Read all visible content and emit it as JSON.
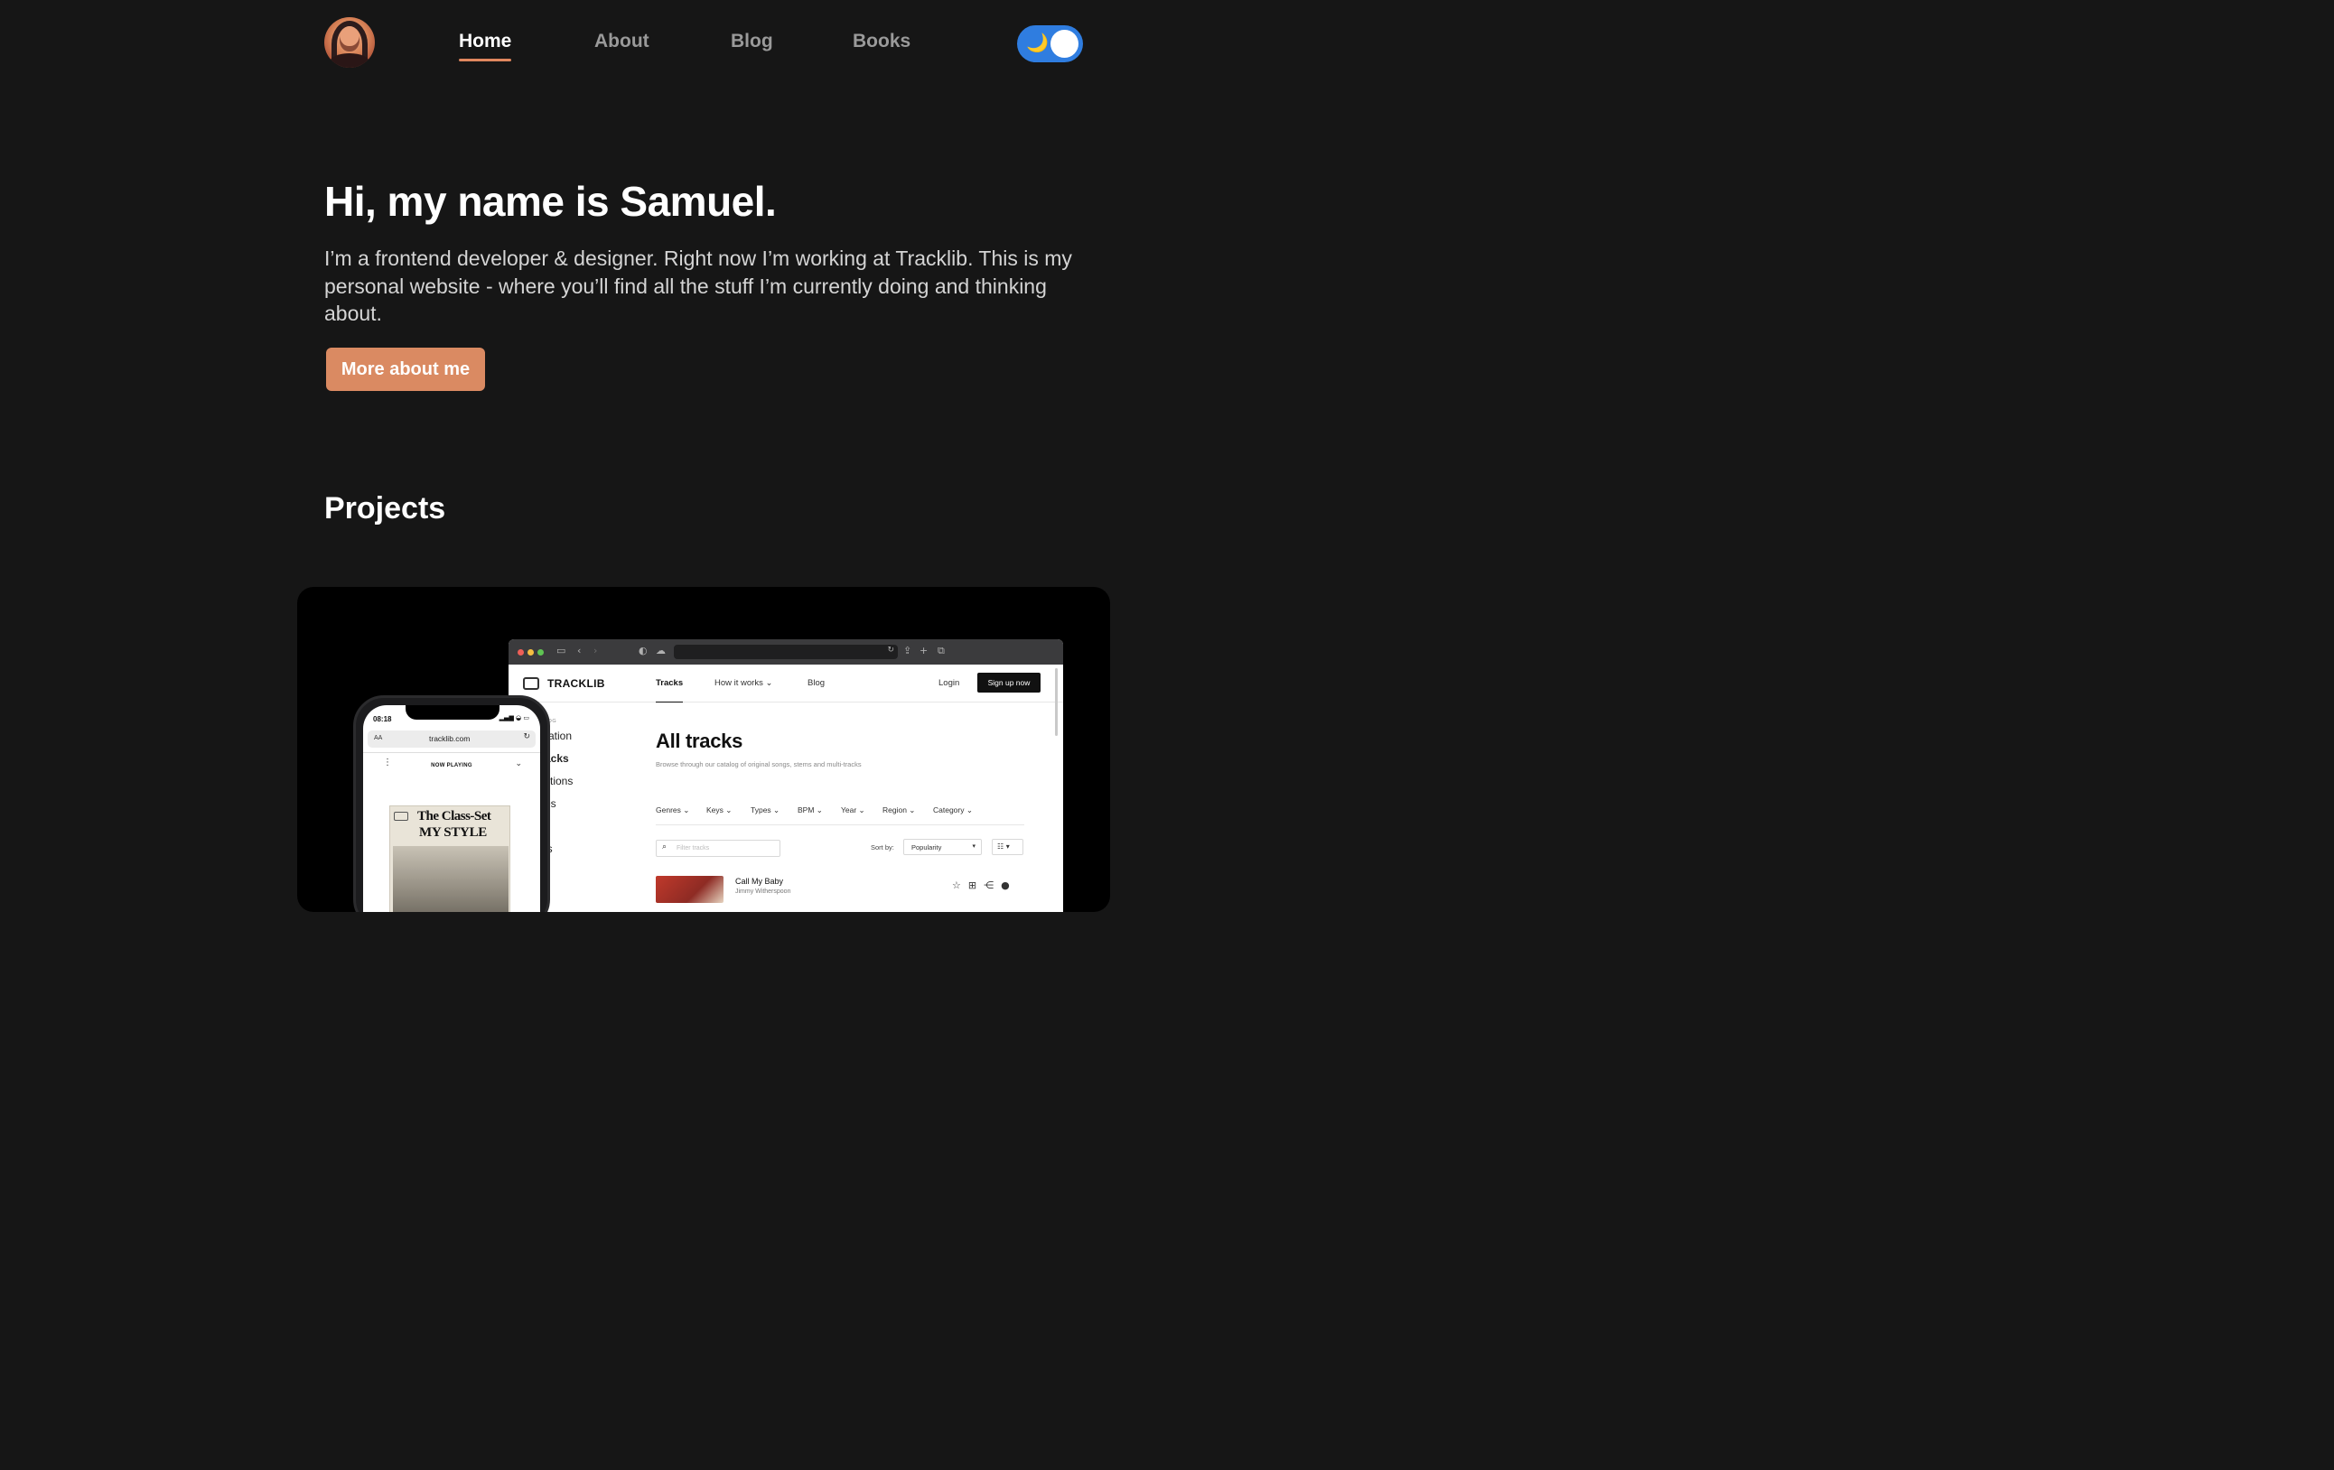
{
  "nav": {
    "avatar_alt": "Samuel",
    "links": [
      {
        "label": "Home",
        "active": true
      },
      {
        "label": "About",
        "active": false
      },
      {
        "label": "Blog",
        "active": false
      },
      {
        "label": "Books",
        "active": false
      }
    ],
    "theme_toggle": {
      "icon": "moon-icon",
      "state": "dark",
      "moon_glyph": "🌙"
    }
  },
  "hero": {
    "title": "Hi, my name is Samuel.",
    "text": "I’m a frontend developer & designer. Right now I’m working at Tracklib. This is my personal website - where you’ll find all the stuff I’m currently doing and thinking about.",
    "cta_label": "More about me"
  },
  "projects": {
    "title": "Projects",
    "tracklib_preview": {
      "browser": {
        "logo_text": "TRACKLIB",
        "nav": [
          "Tracks",
          "How it works ⌄",
          "Blog"
        ],
        "login": "Login",
        "signup": "Sign up now",
        "sidebar_fragments": [
          "ration",
          "acks",
          "ctions",
          "es",
          "s",
          "ls"
        ],
        "catalog_small": "LOG",
        "heading": "All tracks",
        "subheading": "Browse through our catalog of original songs, stems and multi-tracks",
        "filters": [
          "Genres ⌄",
          "Keys ⌄",
          "Types ⌄",
          "BPM ⌄",
          "Year ⌄",
          "Region ⌄",
          "Category ⌄"
        ],
        "search_placeholder": "Filter tracks",
        "sort_label": "Sort by:",
        "sort_value": "Popularity",
        "track": {
          "title": "Call My Baby",
          "artist": "Jimmy Witherspoon"
        }
      },
      "phone": {
        "time": "08:18",
        "aa": "AA",
        "domain": "tracklib.com",
        "now_playing": "NOW PLAYING",
        "album_line1": "The Class-Set",
        "album_line2": "MY STYLE"
      }
    }
  },
  "colors": {
    "background": "#161616",
    "accent": "#da8a62",
    "toggle": "#2f7de0",
    "nav_inactive": "#9a9a9a"
  }
}
